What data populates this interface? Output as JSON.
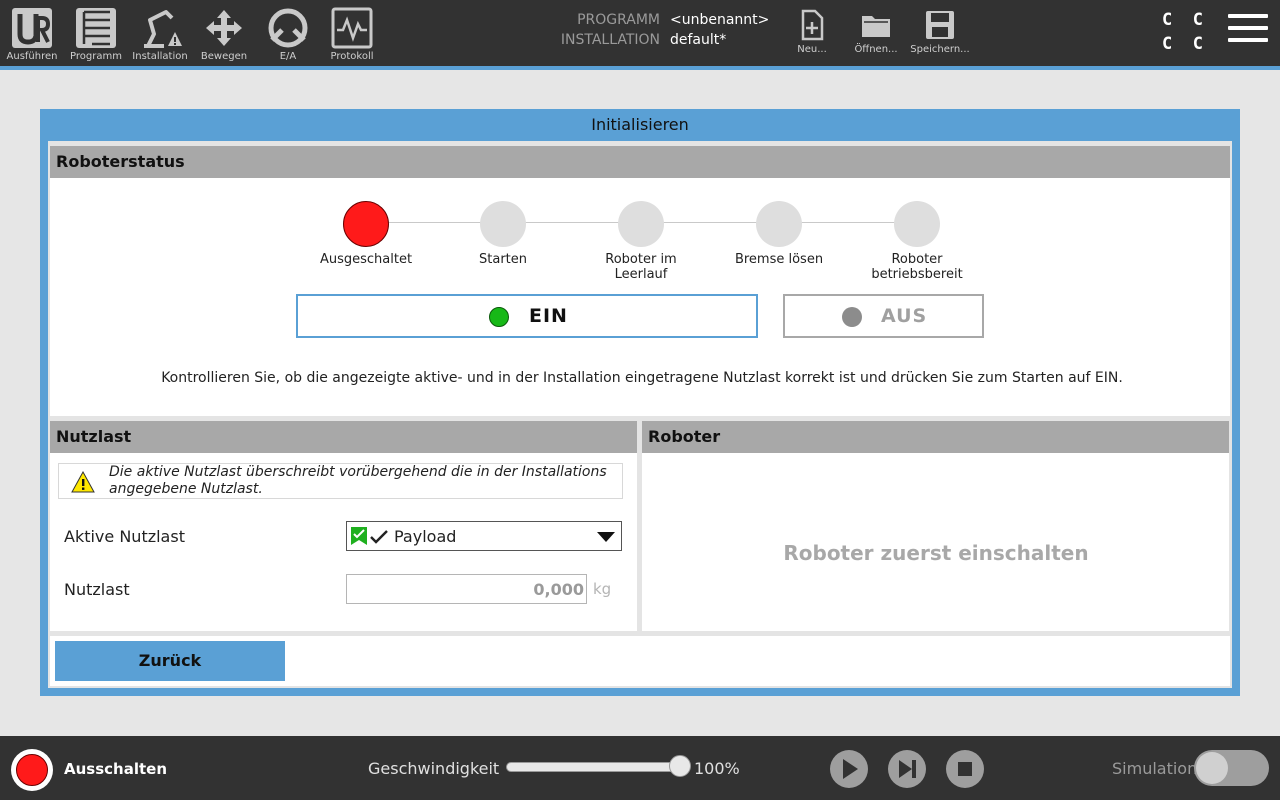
{
  "nav": [
    {
      "label": "Ausführen",
      "icon": "ur-logo-icon"
    },
    {
      "label": "Programm",
      "icon": "program-tree-icon"
    },
    {
      "label": "Installation",
      "icon": "installation-robot-icon"
    },
    {
      "label": "Bewegen",
      "icon": "move-arrows-icon"
    },
    {
      "label": "E/A",
      "icon": "io-icon"
    },
    {
      "label": "Protokoll",
      "icon": "log-icon"
    }
  ],
  "program": {
    "program_label": "PROGRAMM",
    "program_value": "<unbenannt>",
    "installation_label": "INSTALLATION",
    "installation_value": "default*"
  },
  "file_actions": [
    {
      "label": "Neu...",
      "icon": "new-file-icon"
    },
    {
      "label": "Öffnen...",
      "icon": "open-folder-icon"
    },
    {
      "label": "Speichern...",
      "icon": "save-disk-icon"
    }
  ],
  "cc_indicator": [
    "C",
    "C",
    "C",
    "C"
  ],
  "dialog": {
    "title": "Initialisieren",
    "status_header": "Roboterstatus",
    "steps": [
      {
        "label": "Ausgeschaltet",
        "active": true
      },
      {
        "label": "Starten",
        "active": false
      },
      {
        "label": "Roboter im Leerlauf",
        "active": false
      },
      {
        "label": "Bremse lösen",
        "active": false
      },
      {
        "label": "Roboter betriebsbereit",
        "active": false
      }
    ],
    "on_button": "EIN",
    "off_button": "AUS",
    "instruction": "Kontrollieren Sie, ob die angezeigte aktive- und in der Installation eingetragene Nutzlast korrekt ist und drücken Sie zum Starten auf EIN.",
    "payload": {
      "header": "Nutzlast",
      "warning": "Die aktive Nutzlast überschreibt vorübergehend die in der Installations angegebene Nutzlast.",
      "active_label": "Aktive Nutzlast",
      "active_value": "Payload",
      "payload_label": "Nutzlast",
      "payload_value": "0,000",
      "payload_unit": "kg"
    },
    "robot": {
      "header": "Roboter",
      "message": "Roboter zuerst einschalten"
    },
    "back_button": "Zurück"
  },
  "bottom": {
    "power_label": "Ausschalten",
    "speed_label": "Geschwindigkeit",
    "speed_value": "100%",
    "speed_percent": 100,
    "simulation_label": "Simulation",
    "simulation_on": false
  },
  "colors": {
    "accent": "#5aa0d5",
    "topbar": "#323232",
    "power_off_red": "#ff1a1a",
    "ein_green": "#17b817",
    "aus_grey": "#8c8c8c"
  }
}
